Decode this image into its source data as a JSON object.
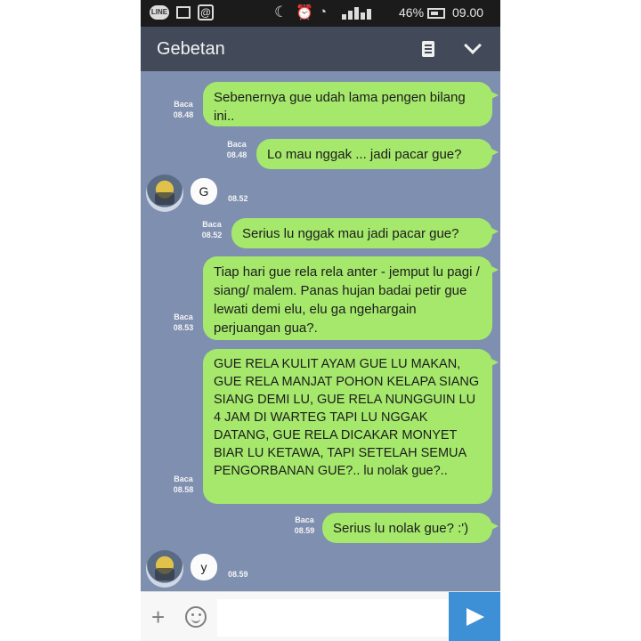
{
  "status_bar": {
    "battery": "46%",
    "time": "09.00",
    "icons": [
      "line-icon",
      "image-icon",
      "at-icon",
      "moon-icon",
      "alarm-icon",
      "wifi-icon",
      "signal-icon",
      "battery-icon"
    ]
  },
  "header": {
    "title": "Gebetan",
    "icons": [
      "notes-icon",
      "chevron-down-icon"
    ]
  },
  "messages": [
    {
      "from": "me",
      "text": "Sebenernya gue udah lama pengen bilang ini..",
      "read": "Baca",
      "time": "08.48"
    },
    {
      "from": "me",
      "text": "Lo mau nggak ... jadi pacar gue?",
      "read": "Baca",
      "time": "08.48"
    },
    {
      "from": "them",
      "text": "G",
      "time": "08.52"
    },
    {
      "from": "me",
      "text": "Serius lu nggak mau jadi pacar gue?",
      "read": "Baca",
      "time": "08.52"
    },
    {
      "from": "me",
      "text": "Tiap hari gue rela rela anter - jemput lu pagi / siang/ malem. Panas hujan badai petir gue lewati demi elu, elu ga ngehargain perjuangan gua?.",
      "read": "Baca",
      "time": "08.53"
    },
    {
      "from": "me",
      "text": "GUE RELA KULIT AYAM GUE LU MAKAN, GUE RELA MANJAT POHON KELAPA SIANG SIANG DEMI LU, GUE RELA NUNGGUIN LU 4 JAM DI WARTEG TAPI LU NGGAK DATANG, GUE RELA DICAKAR MONYET BIAR LU KETAWA, TAPI SETELAH SEMUA PENGORBANAN GUE?.. lu nolak gue?..",
      "read": "Baca",
      "time": "08.58"
    },
    {
      "from": "me",
      "text": "Serius lu nolak gue? :')",
      "read": "Baca",
      "time": "08.59"
    },
    {
      "from": "them",
      "text": "y",
      "time": "08.59"
    }
  ],
  "input_bar": {
    "icons": [
      "plus-icon",
      "emoji-icon",
      "send-icon"
    ]
  },
  "colors": {
    "chat_background": "#7e8fb0",
    "header": "#424a5a",
    "outgoing_bubble": "#a5e86c",
    "incoming_bubble": "#fbfbfb",
    "send_button": "#3d8fd6"
  }
}
